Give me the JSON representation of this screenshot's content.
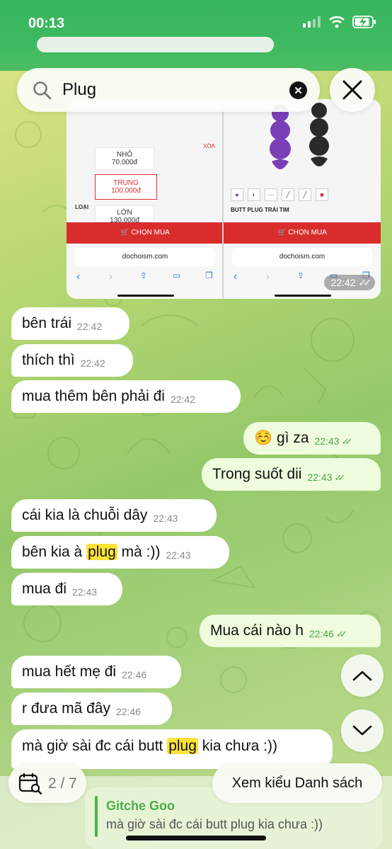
{
  "status_bar": {
    "time": "00:13"
  },
  "search": {
    "query": "Plug",
    "clear_icon": "x-circle-icon",
    "close_icon": "close-icon"
  },
  "media": {
    "time": "22:42",
    "left_shot": {
      "options": [
        {
          "label": "NHỎ",
          "price": "70.000đ"
        },
        {
          "label": "TRUNG",
          "price": "100.000đ"
        },
        {
          "label": "LỚN",
          "price": "130.000đ"
        }
      ],
      "remove_label": "XÓA",
      "type_label": "LOẠI",
      "buy_label": "CHỌN MUA",
      "url": "dochoism.com"
    },
    "right_shot": {
      "product_name": "BUTT PLUG TRÁI TIM",
      "buy_label": "CHỌN MUA",
      "url": "dochoism.com"
    }
  },
  "messages": [
    {
      "dir": "in",
      "text": "bên trái",
      "time": "22:42"
    },
    {
      "dir": "in",
      "text": "thích thì",
      "time": "22:42"
    },
    {
      "dir": "in",
      "text": "mua thêm bên phải đi",
      "time": "22:42"
    },
    {
      "dir": "out",
      "emoji": "☺️",
      "text": "gì za",
      "time": "22:43"
    },
    {
      "dir": "out",
      "text": "Trong suốt dii",
      "time": "22:43"
    },
    {
      "dir": "in",
      "text": "cái kia là chuỗi dây",
      "time": "22:43"
    },
    {
      "dir": "in",
      "pre": "bên kia à",
      "highlight": "plug",
      "post": "mà :))",
      "time": "22:43"
    },
    {
      "dir": "in",
      "text": "mua đi",
      "time": "22:43"
    },
    {
      "dir": "out",
      "text": "Mua cái nào h",
      "time": "22:46"
    },
    {
      "dir": "in",
      "text": "mua hết mẹ đi",
      "time": "22:46"
    },
    {
      "dir": "in",
      "text": "r đưa mã đây",
      "time": "22:46"
    },
    {
      "dir": "in",
      "pre": "mà giờ sài đc cái butt",
      "highlight": "plug",
      "post": "kia chưa :))",
      "time": ""
    }
  ],
  "search_results": {
    "counter": "2 / 7",
    "list_view_label": "Xem kiểu Danh sách"
  },
  "reply_preview": {
    "name": "Gitche Goo",
    "text": "mà giờ sài đc cái butt plug kia chưa :))"
  },
  "colors": {
    "accent_green": "#4aae4a",
    "highlight": "#ffe23a",
    "out_bubble": "#effdde"
  }
}
